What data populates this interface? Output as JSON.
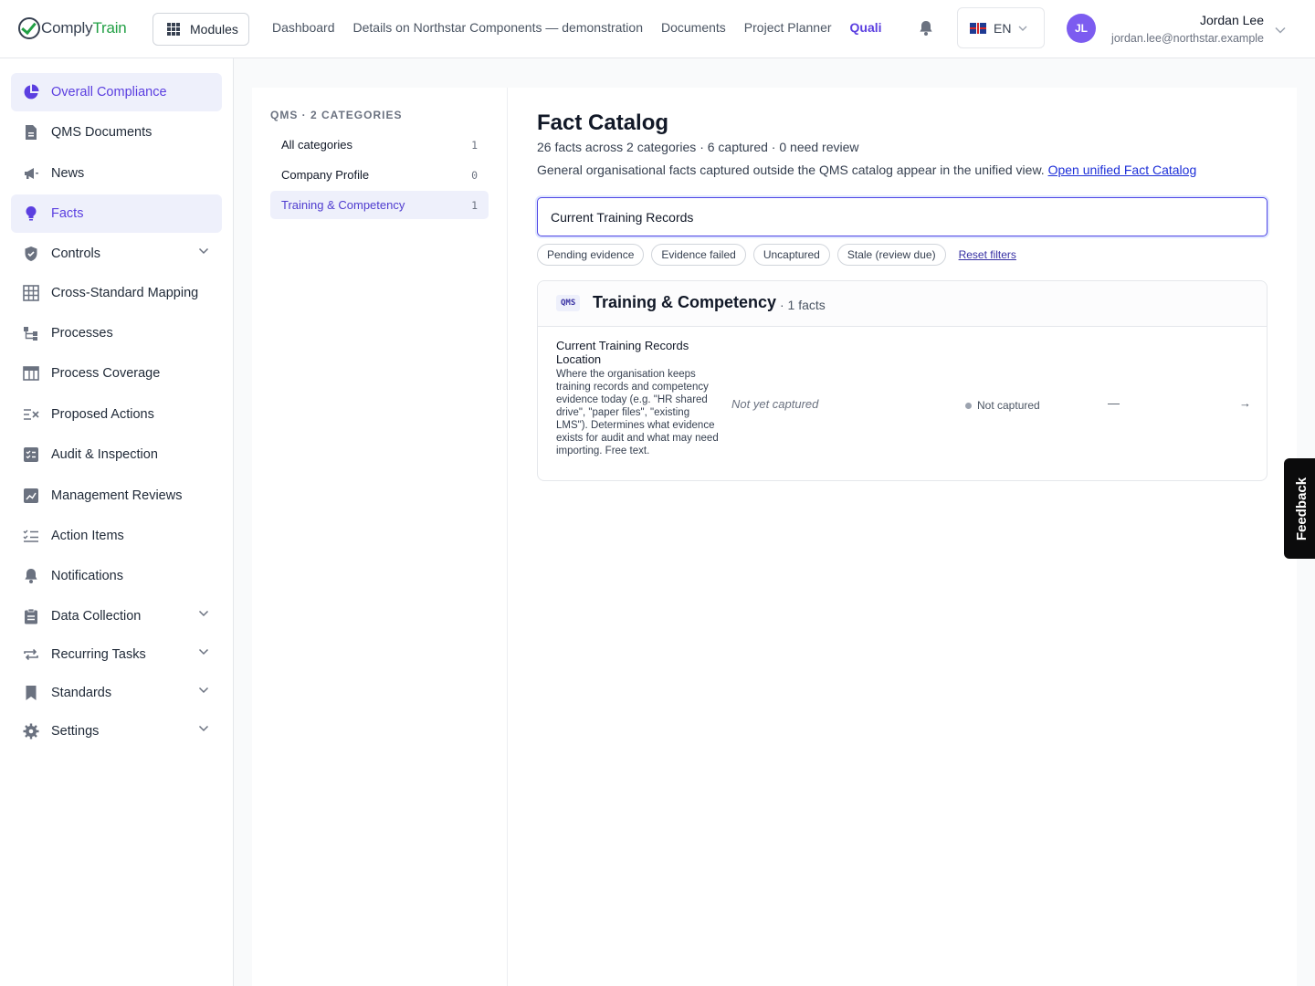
{
  "app": {
    "logo_part1": "Comply",
    "logo_part2": "Train",
    "modules_label": "Modules"
  },
  "topnav": {
    "items": [
      "Dashboard",
      "Details on Northstar Components — demonstration",
      "Documents",
      "Project Planner",
      "Quali"
    ]
  },
  "language": {
    "code": "EN"
  },
  "user": {
    "initials": "JL",
    "name": "Jordan Lee",
    "email": "jordan.lee@northstar.example"
  },
  "sidebar": {
    "items": [
      {
        "label": "Overall Compliance",
        "icon": "pie-chart-icon"
      },
      {
        "label": "QMS Documents",
        "icon": "document-icon"
      },
      {
        "label": "News",
        "icon": "megaphone-icon"
      },
      {
        "label": "Facts",
        "icon": "lightbulb-icon"
      },
      {
        "label": "Controls",
        "icon": "shield-check-icon"
      },
      {
        "label": "Cross-Standard Mapping",
        "icon": "table-grid-icon"
      },
      {
        "label": "Processes",
        "icon": "flow-icon"
      },
      {
        "label": "Process Coverage",
        "icon": "layout-table-icon"
      },
      {
        "label": "Proposed Actions",
        "icon": "list-x-icon"
      },
      {
        "label": "Audit & Inspection",
        "icon": "checklist-box-icon"
      },
      {
        "label": "Management Reviews",
        "icon": "chart-line-box-icon"
      },
      {
        "label": "Action Items",
        "icon": "list-check-icon"
      },
      {
        "label": "Notifications",
        "icon": "bell-icon"
      },
      {
        "label": "Data Collection",
        "icon": "clipboard-icon"
      },
      {
        "label": "Recurring Tasks",
        "icon": "repeat-icon"
      },
      {
        "label": "Standards",
        "icon": "bookmark-icon"
      },
      {
        "label": "Settings",
        "icon": "gear-icon"
      }
    ]
  },
  "categories": {
    "title": "QMS · 2 CATEGORIES",
    "items": [
      {
        "label": "All categories",
        "count": "1"
      },
      {
        "label": "Company Profile",
        "count": "0"
      },
      {
        "label": "Training & Competency",
        "count": "1"
      }
    ]
  },
  "catalog": {
    "title": "Fact Catalog",
    "stats": "26 facts across 2 categories · 6 captured · 0 need review",
    "note": "General organisational facts captured outside the QMS catalog appear in the unified view.",
    "note_link": "Open unified Fact Catalog",
    "search_value": "Current Training Records",
    "filters": [
      "Pending evidence",
      "Evidence failed",
      "Uncaptured",
      "Stale (review due)"
    ],
    "reset_label": "Reset filters"
  },
  "group": {
    "badge": "QMS",
    "title": "Training & Competency",
    "count": "· 1 facts",
    "fact": {
      "title": "Current Training Records Location",
      "description": "Where the organisation keeps training records and competency evidence today (e.g. \"HR shared drive\", \"paper files\", \"existing LMS\"). Determines what evidence exists for audit and what may need importing. Free text.",
      "value": "Not yet captured",
      "status": "Not captured",
      "dash": "—",
      "arrow": "→"
    }
  },
  "feedback_label": "Feedback",
  "colors": {
    "accent": "#5b3fe0",
    "brand_green": "#22a045",
    "active_bg": "#eef0fb"
  }
}
